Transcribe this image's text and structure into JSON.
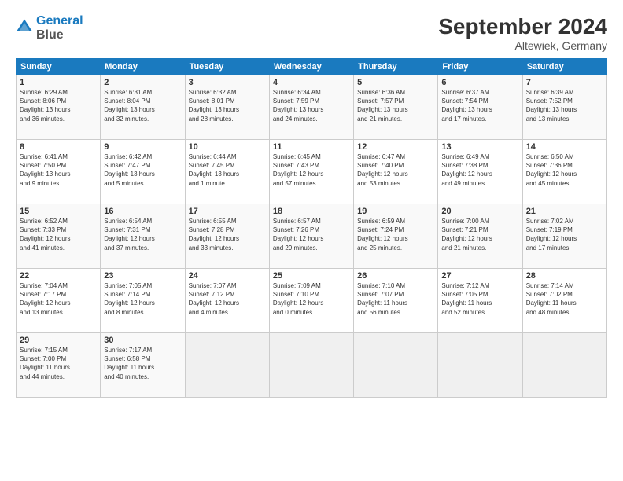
{
  "logo": {
    "line1": "General",
    "line2": "Blue"
  },
  "title": "September 2024",
  "subtitle": "Altewiek, Germany",
  "headers": [
    "Sunday",
    "Monday",
    "Tuesday",
    "Wednesday",
    "Thursday",
    "Friday",
    "Saturday"
  ],
  "rows": [
    [
      {
        "day": "1",
        "info": "Sunrise: 6:29 AM\nSunset: 8:06 PM\nDaylight: 13 hours\nand 36 minutes."
      },
      {
        "day": "2",
        "info": "Sunrise: 6:31 AM\nSunset: 8:04 PM\nDaylight: 13 hours\nand 32 minutes."
      },
      {
        "day": "3",
        "info": "Sunrise: 6:32 AM\nSunset: 8:01 PM\nDaylight: 13 hours\nand 28 minutes."
      },
      {
        "day": "4",
        "info": "Sunrise: 6:34 AM\nSunset: 7:59 PM\nDaylight: 13 hours\nand 24 minutes."
      },
      {
        "day": "5",
        "info": "Sunrise: 6:36 AM\nSunset: 7:57 PM\nDaylight: 13 hours\nand 21 minutes."
      },
      {
        "day": "6",
        "info": "Sunrise: 6:37 AM\nSunset: 7:54 PM\nDaylight: 13 hours\nand 17 minutes."
      },
      {
        "day": "7",
        "info": "Sunrise: 6:39 AM\nSunset: 7:52 PM\nDaylight: 13 hours\nand 13 minutes."
      }
    ],
    [
      {
        "day": "8",
        "info": "Sunrise: 6:41 AM\nSunset: 7:50 PM\nDaylight: 13 hours\nand 9 minutes."
      },
      {
        "day": "9",
        "info": "Sunrise: 6:42 AM\nSunset: 7:47 PM\nDaylight: 13 hours\nand 5 minutes."
      },
      {
        "day": "10",
        "info": "Sunrise: 6:44 AM\nSunset: 7:45 PM\nDaylight: 13 hours\nand 1 minute."
      },
      {
        "day": "11",
        "info": "Sunrise: 6:45 AM\nSunset: 7:43 PM\nDaylight: 12 hours\nand 57 minutes."
      },
      {
        "day": "12",
        "info": "Sunrise: 6:47 AM\nSunset: 7:40 PM\nDaylight: 12 hours\nand 53 minutes."
      },
      {
        "day": "13",
        "info": "Sunrise: 6:49 AM\nSunset: 7:38 PM\nDaylight: 12 hours\nand 49 minutes."
      },
      {
        "day": "14",
        "info": "Sunrise: 6:50 AM\nSunset: 7:36 PM\nDaylight: 12 hours\nand 45 minutes."
      }
    ],
    [
      {
        "day": "15",
        "info": "Sunrise: 6:52 AM\nSunset: 7:33 PM\nDaylight: 12 hours\nand 41 minutes."
      },
      {
        "day": "16",
        "info": "Sunrise: 6:54 AM\nSunset: 7:31 PM\nDaylight: 12 hours\nand 37 minutes."
      },
      {
        "day": "17",
        "info": "Sunrise: 6:55 AM\nSunset: 7:28 PM\nDaylight: 12 hours\nand 33 minutes."
      },
      {
        "day": "18",
        "info": "Sunrise: 6:57 AM\nSunset: 7:26 PM\nDaylight: 12 hours\nand 29 minutes."
      },
      {
        "day": "19",
        "info": "Sunrise: 6:59 AM\nSunset: 7:24 PM\nDaylight: 12 hours\nand 25 minutes."
      },
      {
        "day": "20",
        "info": "Sunrise: 7:00 AM\nSunset: 7:21 PM\nDaylight: 12 hours\nand 21 minutes."
      },
      {
        "day": "21",
        "info": "Sunrise: 7:02 AM\nSunset: 7:19 PM\nDaylight: 12 hours\nand 17 minutes."
      }
    ],
    [
      {
        "day": "22",
        "info": "Sunrise: 7:04 AM\nSunset: 7:17 PM\nDaylight: 12 hours\nand 13 minutes."
      },
      {
        "day": "23",
        "info": "Sunrise: 7:05 AM\nSunset: 7:14 PM\nDaylight: 12 hours\nand 8 minutes."
      },
      {
        "day": "24",
        "info": "Sunrise: 7:07 AM\nSunset: 7:12 PM\nDaylight: 12 hours\nand 4 minutes."
      },
      {
        "day": "25",
        "info": "Sunrise: 7:09 AM\nSunset: 7:10 PM\nDaylight: 12 hours\nand 0 minutes."
      },
      {
        "day": "26",
        "info": "Sunrise: 7:10 AM\nSunset: 7:07 PM\nDaylight: 11 hours\nand 56 minutes."
      },
      {
        "day": "27",
        "info": "Sunrise: 7:12 AM\nSunset: 7:05 PM\nDaylight: 11 hours\nand 52 minutes."
      },
      {
        "day": "28",
        "info": "Sunrise: 7:14 AM\nSunset: 7:02 PM\nDaylight: 11 hours\nand 48 minutes."
      }
    ],
    [
      {
        "day": "29",
        "info": "Sunrise: 7:15 AM\nSunset: 7:00 PM\nDaylight: 11 hours\nand 44 minutes."
      },
      {
        "day": "30",
        "info": "Sunrise: 7:17 AM\nSunset: 6:58 PM\nDaylight: 11 hours\nand 40 minutes."
      },
      {
        "day": "",
        "info": ""
      },
      {
        "day": "",
        "info": ""
      },
      {
        "day": "",
        "info": ""
      },
      {
        "day": "",
        "info": ""
      },
      {
        "day": "",
        "info": ""
      }
    ]
  ]
}
